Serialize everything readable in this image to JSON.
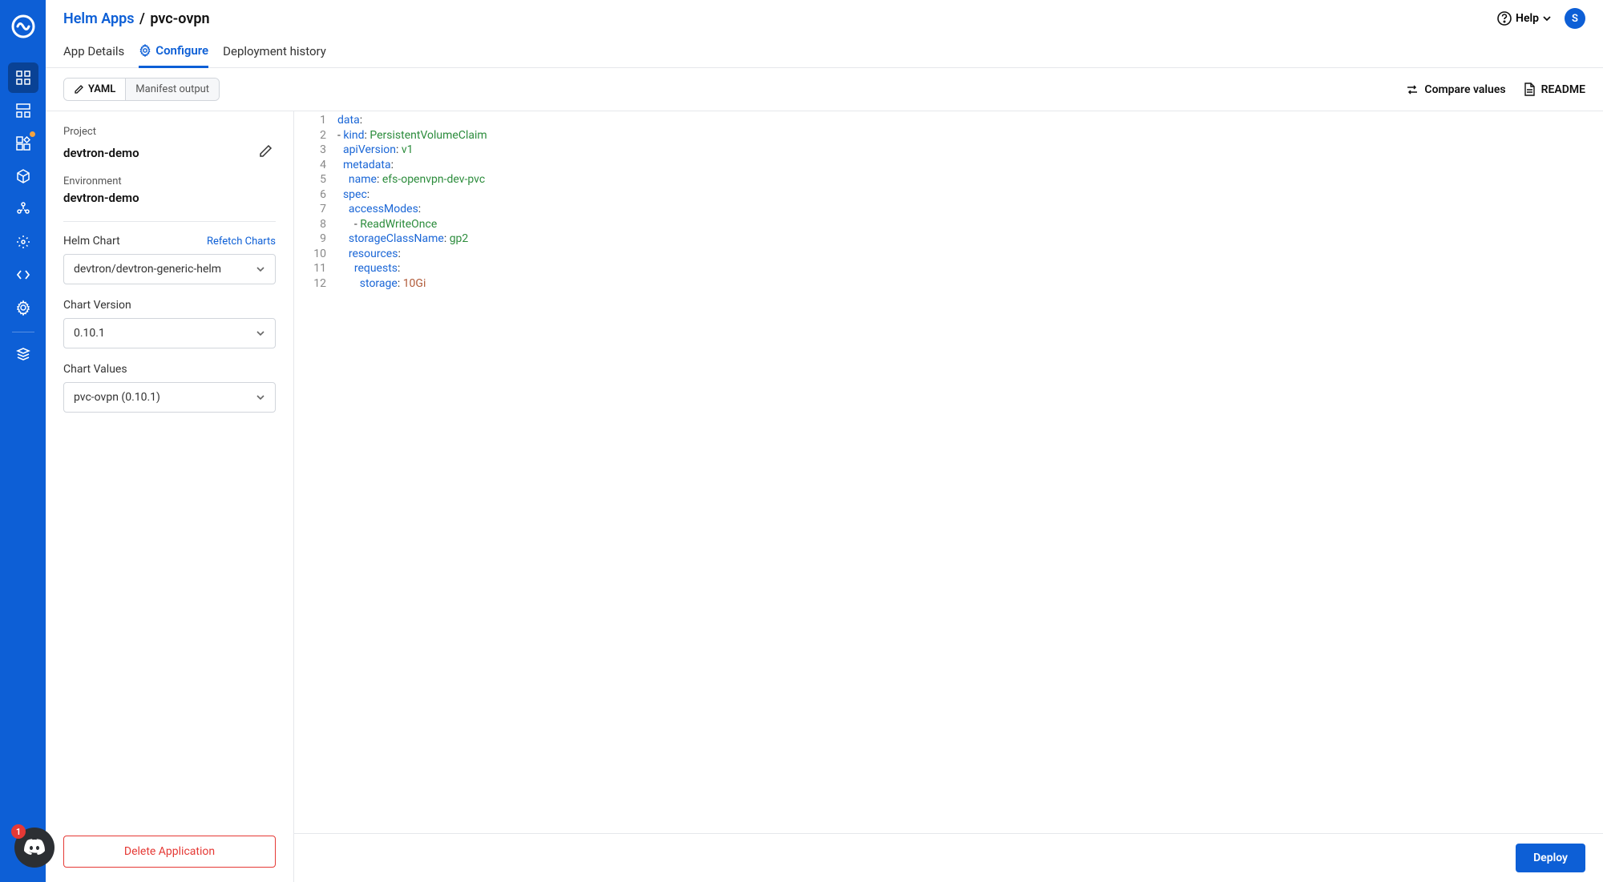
{
  "header": {
    "breadcrumb_link": "Helm Apps",
    "breadcrumb_sep": "/",
    "breadcrumb_current": "pvc-ovpn",
    "help_label": "Help",
    "avatar_initial": "S"
  },
  "tabs": {
    "app_details": "App Details",
    "configure": "Configure",
    "deployment_history": "Deployment history"
  },
  "toolbar": {
    "yaml": "YAML",
    "manifest_output": "Manifest output",
    "compare_values": "Compare values",
    "readme": "README"
  },
  "config": {
    "project_label": "Project",
    "project_value": "devtron-demo",
    "environment_label": "Environment",
    "environment_value": "devtron-demo",
    "helm_chart_label": "Helm Chart",
    "refetch_charts": "Refetch Charts",
    "helm_chart_value": "devtron/devtron-generic-helm",
    "chart_version_label": "Chart Version",
    "chart_version_value": "0.10.1",
    "chart_values_label": "Chart Values",
    "chart_values_value": "pvc-ovpn (0.10.1)",
    "delete_label": "Delete Application"
  },
  "editor": {
    "lines": [
      {
        "n": "1",
        "html": "<span class='tok-key'>data</span><span class='tok-punct'>:</span>"
      },
      {
        "n": "2",
        "html": "<span class='tok-punct'>- </span><span class='tok-key'>kind</span><span class='tok-punct'>: </span><span class='tok-str'>PersistentVolumeClaim</span>"
      },
      {
        "n": "3",
        "html": "  <span class='tok-key'>apiVersion</span><span class='tok-punct'>: </span><span class='tok-str'>v1</span>"
      },
      {
        "n": "4",
        "html": "  <span class='tok-key'>metadata</span><span class='tok-punct'>:</span>"
      },
      {
        "n": "5",
        "html": "    <span class='tok-key'>name</span><span class='tok-punct'>: </span><span class='tok-str'>efs-openvpn-dev-pvc</span>"
      },
      {
        "n": "6",
        "html": "  <span class='tok-key'>spec</span><span class='tok-punct'>:</span>"
      },
      {
        "n": "7",
        "html": "    <span class='tok-key'>accessModes</span><span class='tok-punct'>:</span>"
      },
      {
        "n": "8",
        "html": "      <span class='tok-punct'>- </span><span class='tok-str'>ReadWriteOnce</span>"
      },
      {
        "n": "9",
        "html": "    <span class='tok-key'>storageClassName</span><span class='tok-punct'>: </span><span class='tok-str'>gp2</span>"
      },
      {
        "n": "10",
        "html": "    <span class='tok-key'>resources</span><span class='tok-punct'>:</span>"
      },
      {
        "n": "11",
        "html": "      <span class='tok-key'>requests</span><span class='tok-punct'>:</span>"
      },
      {
        "n": "12",
        "html": "        <span class='tok-key'>storage</span><span class='tok-punct'>: </span><span class='tok-num'>10Gi</span>"
      }
    ]
  },
  "footer": {
    "deploy_label": "Deploy"
  },
  "discord": {
    "badge": "1"
  }
}
